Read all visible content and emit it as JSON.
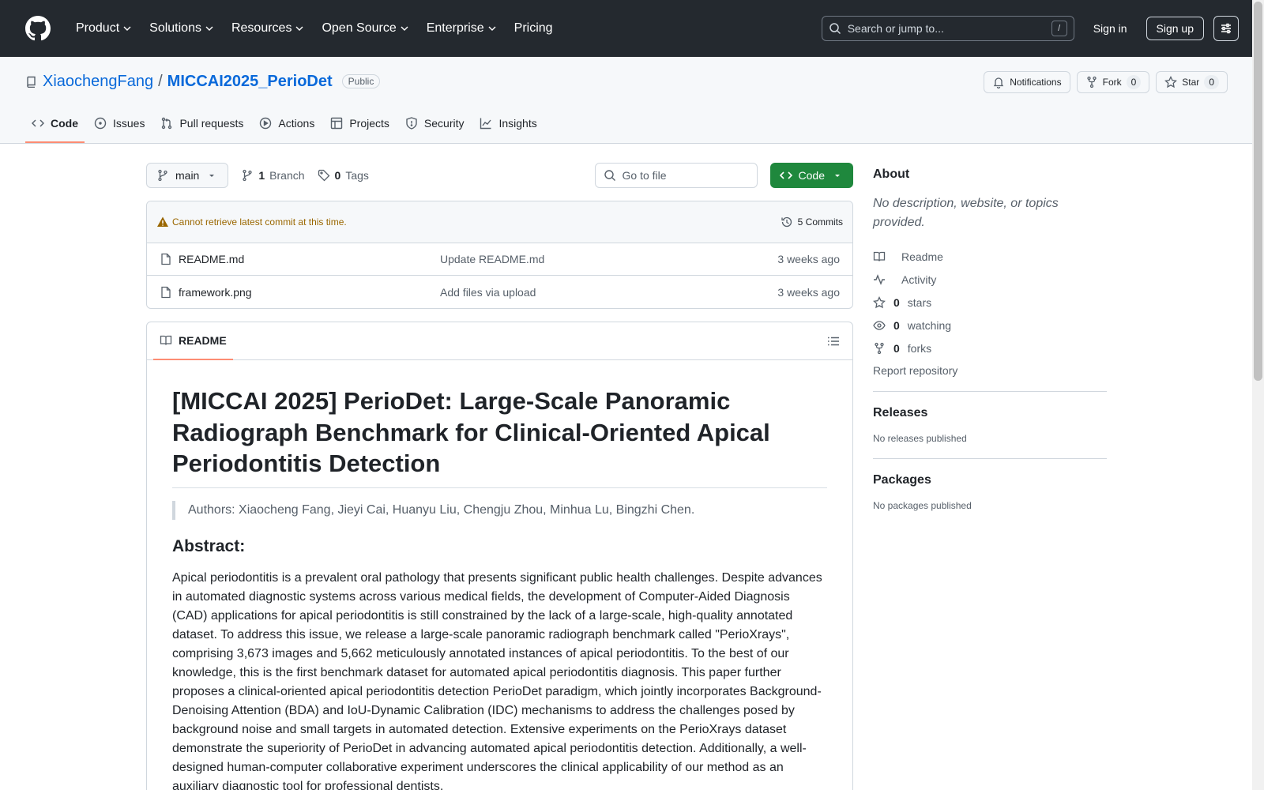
{
  "header": {
    "nav": [
      {
        "label": "Product"
      },
      {
        "label": "Solutions"
      },
      {
        "label": "Resources"
      },
      {
        "label": "Open Source"
      },
      {
        "label": "Enterprise"
      },
      {
        "label": "Pricing"
      }
    ],
    "search_placeholder": "Search or jump to...",
    "search_shortcut": "/",
    "signin": "Sign in",
    "signup": "Sign up"
  },
  "repo": {
    "owner": "XiaochengFang",
    "separator": "/",
    "name": "MICCAI2025_PerioDet",
    "visibility": "Public",
    "notifications": "Notifications",
    "fork_label": "Fork",
    "fork_count": "0",
    "star_label": "Star",
    "star_count": "0"
  },
  "tabs": [
    {
      "label": "Code",
      "icon": "code-icon"
    },
    {
      "label": "Issues",
      "icon": "issue-icon"
    },
    {
      "label": "Pull requests",
      "icon": "pull-request-icon"
    },
    {
      "label": "Actions",
      "icon": "play-icon"
    },
    {
      "label": "Projects",
      "icon": "table-icon"
    },
    {
      "label": "Security",
      "icon": "shield-icon"
    },
    {
      "label": "Insights",
      "icon": "graph-icon"
    }
  ],
  "toolbar": {
    "branch": "main",
    "branch_count": "1",
    "branch_label": "Branch",
    "tag_count": "0",
    "tag_label": "Tags",
    "goto_placeholder": "Go to file",
    "code_button": "Code"
  },
  "commit_bar": {
    "warning": "Cannot retrieve latest commit at this time.",
    "commits": "5 Commits"
  },
  "files": [
    {
      "name": "README.md",
      "message": "Update README.md",
      "time": "3 weeks ago"
    },
    {
      "name": "framework.png",
      "message": "Add files via upload",
      "time": "3 weeks ago"
    }
  ],
  "readme": {
    "tab": "README",
    "title": "[MICCAI 2025] PerioDet: Large-Scale Panoramic Radiograph Benchmark for Clinical-Oriented Apical Periodontitis Detection",
    "authors": "Authors: Xiaocheng Fang, Jieyi Cai, Huanyu Liu, Chengju Zhou, Minhua Lu, Bingzhi Chen.",
    "abstract_heading": "Abstract:",
    "abstract": "Apical periodontitis is a prevalent oral pathology that presents significant public health challenges. Despite advances in automated diagnostic systems across various medical fields, the development of Computer-Aided Diagnosis (CAD) applications for apical periodontitis is still constrained by the lack of a large-scale, high-quality annotated dataset. To address this issue, we release a large-scale panoramic radiograph benchmark called \"PerioXrays\", comprising 3,673 images and 5,662 meticulously annotated instances of apical periodontitis. To the best of our knowledge, this is the first benchmark dataset for automated apical periodontitis diagnosis. This paper further proposes a clinical-oriented apical periodontitis detection PerioDet paradigm, which jointly incorporates Background-Denoising Attention (BDA) and IoU-Dynamic Calibration (IDC) mechanisms to address the challenges posed by background noise and small targets in automated detection. Extensive experiments on the PerioXrays dataset demonstrate the superiority of PerioDet in advancing automated apical periodontitis detection. Additionally, a well-designed human-computer collaborative experiment underscores the clinical applicability of our method as an auxiliary diagnostic tool for professional dentists."
  },
  "sidebar": {
    "about_heading": "About",
    "description": "No description, website, or topics provided.",
    "items": [
      {
        "icon": "book-icon",
        "count": "",
        "label": "Readme"
      },
      {
        "icon": "pulse-icon",
        "count": "",
        "label": "Activity"
      },
      {
        "icon": "star-icon",
        "count": "0",
        "label": "stars"
      },
      {
        "icon": "eye-icon",
        "count": "0",
        "label": "watching"
      },
      {
        "icon": "fork-icon",
        "count": "0",
        "label": "forks"
      }
    ],
    "report": "Report repository",
    "releases_heading": "Releases",
    "releases_text": "No releases published",
    "packages_heading": "Packages",
    "packages_text": "No packages published"
  },
  "colors": {
    "header_bg": "#24292f",
    "link": "#0969da",
    "primary_button": "#1f883d",
    "active_tab_underline": "#fd8c73",
    "warning": "#9a6700"
  }
}
